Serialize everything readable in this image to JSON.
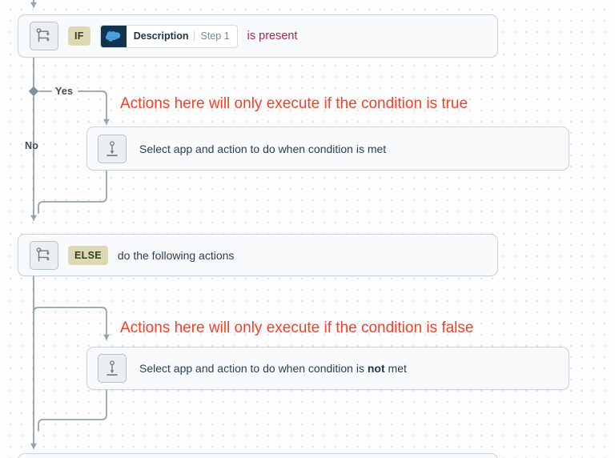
{
  "canvas": {
    "grid": true,
    "background_color": "#fdfdfd",
    "grid_dot_color": "#e2e2e6"
  },
  "colors": {
    "annotation_red": "#f0422a",
    "operator_maroon": "#a02a55",
    "badge_khaki": "#dcd9b4",
    "app_swatch_navy": "#13344e",
    "connector_gray": "#93a3b0",
    "card_border": "#c9d2da"
  },
  "nodes": {
    "if_step": {
      "icon": "branch-icon",
      "keyword": "IF",
      "field": {
        "app_icon": "salesforce-cloud-icon",
        "field_name": "Description",
        "step_label": "Step 1"
      },
      "operator": "is present"
    },
    "true_action": {
      "icon": "action-placeholder-icon",
      "label_prefix": "Select app and action to do when condition is ",
      "label_emphasis": "",
      "label_suffix": "met",
      "full_label": "Select app and action to do when condition is met"
    },
    "else_step": {
      "icon": "branch-icon",
      "keyword": "ELSE",
      "label": "do the following actions"
    },
    "false_action": {
      "icon": "action-placeholder-icon",
      "label_prefix": "Select app and action to do when condition is ",
      "label_emphasis": "not",
      "label_suffix": " met",
      "full_label": "Select app and action to do when condition is not met"
    }
  },
  "branches": {
    "yes_label": "Yes",
    "no_label": "No"
  },
  "annotations": {
    "true_note": "Actions here will only execute if the condition is true",
    "false_note": "Actions here will only execute if the condition is false"
  }
}
